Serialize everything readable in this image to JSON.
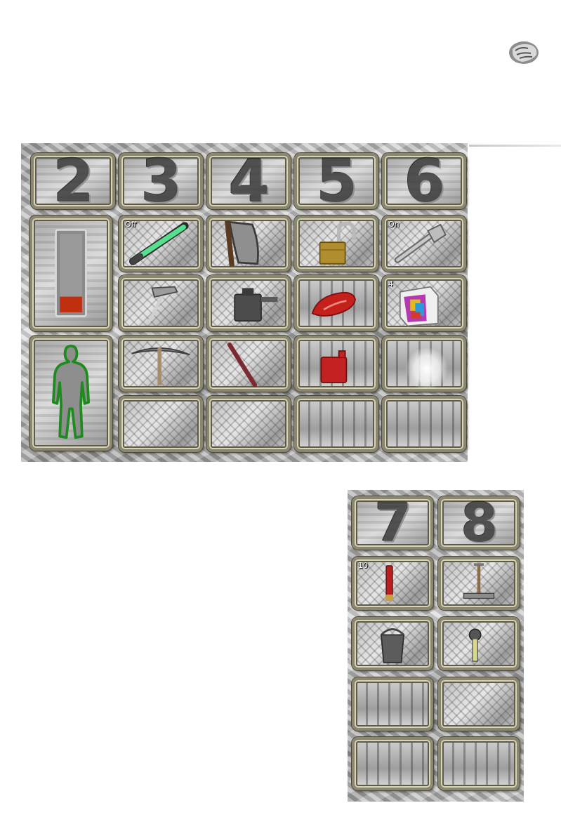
{
  "hotbar_numbers": [
    "2",
    "3",
    "4",
    "5",
    "6"
  ],
  "side_numbers": [
    "7",
    "8"
  ],
  "slots": {
    "glowstick_label": "Off",
    "flashlight_label": "On",
    "ammo_box_count": "4",
    "shells_count": "10"
  },
  "battery": {
    "level": 0.2,
    "fill_color": "#c0300f"
  },
  "body_status": {
    "outline_color": "#1f8a1f"
  },
  "icons": {
    "corner": "character-portrait-icon",
    "battery": "battery-icon",
    "glowstick": "glowstick-icon",
    "hatchet": "hatchet-icon",
    "padlock": "padlock-icon",
    "flashlight": "flashlight-icon",
    "hammer": "hammer-icon",
    "lantern": "lantern-icon",
    "raw_meat": "raw-meat-icon",
    "ammo_box": "ammo-box-icon",
    "pickaxe": "pickaxe-icon",
    "crowbar": "crowbar-icon",
    "fuel_can": "fuel-can-icon",
    "light_orb": "light-orb-icon",
    "shells": "shotgun-shells-icon",
    "shovel": "shovel-icon",
    "bucket": "bucket-icon",
    "wrench": "wrench-icon"
  }
}
